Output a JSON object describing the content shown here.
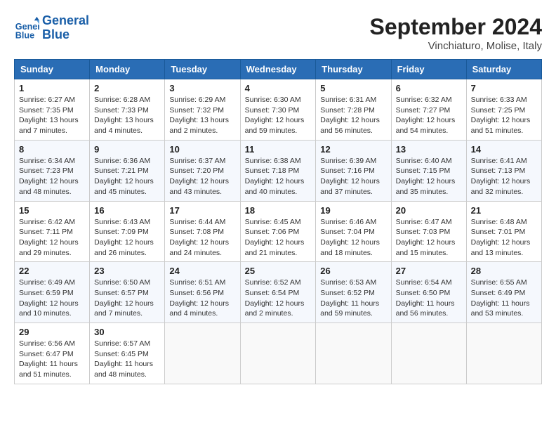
{
  "header": {
    "logo_line1": "General",
    "logo_line2": "Blue",
    "month": "September 2024",
    "location": "Vinchiaturo, Molise, Italy"
  },
  "weekdays": [
    "Sunday",
    "Monday",
    "Tuesday",
    "Wednesday",
    "Thursday",
    "Friday",
    "Saturday"
  ],
  "weeks": [
    [
      {
        "day": "1",
        "info": "Sunrise: 6:27 AM\nSunset: 7:35 PM\nDaylight: 13 hours\nand 7 minutes."
      },
      {
        "day": "2",
        "info": "Sunrise: 6:28 AM\nSunset: 7:33 PM\nDaylight: 13 hours\nand 4 minutes."
      },
      {
        "day": "3",
        "info": "Sunrise: 6:29 AM\nSunset: 7:32 PM\nDaylight: 13 hours\nand 2 minutes."
      },
      {
        "day": "4",
        "info": "Sunrise: 6:30 AM\nSunset: 7:30 PM\nDaylight: 12 hours\nand 59 minutes."
      },
      {
        "day": "5",
        "info": "Sunrise: 6:31 AM\nSunset: 7:28 PM\nDaylight: 12 hours\nand 56 minutes."
      },
      {
        "day": "6",
        "info": "Sunrise: 6:32 AM\nSunset: 7:27 PM\nDaylight: 12 hours\nand 54 minutes."
      },
      {
        "day": "7",
        "info": "Sunrise: 6:33 AM\nSunset: 7:25 PM\nDaylight: 12 hours\nand 51 minutes."
      }
    ],
    [
      {
        "day": "8",
        "info": "Sunrise: 6:34 AM\nSunset: 7:23 PM\nDaylight: 12 hours\nand 48 minutes."
      },
      {
        "day": "9",
        "info": "Sunrise: 6:36 AM\nSunset: 7:21 PM\nDaylight: 12 hours\nand 45 minutes."
      },
      {
        "day": "10",
        "info": "Sunrise: 6:37 AM\nSunset: 7:20 PM\nDaylight: 12 hours\nand 43 minutes."
      },
      {
        "day": "11",
        "info": "Sunrise: 6:38 AM\nSunset: 7:18 PM\nDaylight: 12 hours\nand 40 minutes."
      },
      {
        "day": "12",
        "info": "Sunrise: 6:39 AM\nSunset: 7:16 PM\nDaylight: 12 hours\nand 37 minutes."
      },
      {
        "day": "13",
        "info": "Sunrise: 6:40 AM\nSunset: 7:15 PM\nDaylight: 12 hours\nand 35 minutes."
      },
      {
        "day": "14",
        "info": "Sunrise: 6:41 AM\nSunset: 7:13 PM\nDaylight: 12 hours\nand 32 minutes."
      }
    ],
    [
      {
        "day": "15",
        "info": "Sunrise: 6:42 AM\nSunset: 7:11 PM\nDaylight: 12 hours\nand 29 minutes."
      },
      {
        "day": "16",
        "info": "Sunrise: 6:43 AM\nSunset: 7:09 PM\nDaylight: 12 hours\nand 26 minutes."
      },
      {
        "day": "17",
        "info": "Sunrise: 6:44 AM\nSunset: 7:08 PM\nDaylight: 12 hours\nand 24 minutes."
      },
      {
        "day": "18",
        "info": "Sunrise: 6:45 AM\nSunset: 7:06 PM\nDaylight: 12 hours\nand 21 minutes."
      },
      {
        "day": "19",
        "info": "Sunrise: 6:46 AM\nSunset: 7:04 PM\nDaylight: 12 hours\nand 18 minutes."
      },
      {
        "day": "20",
        "info": "Sunrise: 6:47 AM\nSunset: 7:03 PM\nDaylight: 12 hours\nand 15 minutes."
      },
      {
        "day": "21",
        "info": "Sunrise: 6:48 AM\nSunset: 7:01 PM\nDaylight: 12 hours\nand 13 minutes."
      }
    ],
    [
      {
        "day": "22",
        "info": "Sunrise: 6:49 AM\nSunset: 6:59 PM\nDaylight: 12 hours\nand 10 minutes."
      },
      {
        "day": "23",
        "info": "Sunrise: 6:50 AM\nSunset: 6:57 PM\nDaylight: 12 hours\nand 7 minutes."
      },
      {
        "day": "24",
        "info": "Sunrise: 6:51 AM\nSunset: 6:56 PM\nDaylight: 12 hours\nand 4 minutes."
      },
      {
        "day": "25",
        "info": "Sunrise: 6:52 AM\nSunset: 6:54 PM\nDaylight: 12 hours\nand 2 minutes."
      },
      {
        "day": "26",
        "info": "Sunrise: 6:53 AM\nSunset: 6:52 PM\nDaylight: 11 hours\nand 59 minutes."
      },
      {
        "day": "27",
        "info": "Sunrise: 6:54 AM\nSunset: 6:50 PM\nDaylight: 11 hours\nand 56 minutes."
      },
      {
        "day": "28",
        "info": "Sunrise: 6:55 AM\nSunset: 6:49 PM\nDaylight: 11 hours\nand 53 minutes."
      }
    ],
    [
      {
        "day": "29",
        "info": "Sunrise: 6:56 AM\nSunset: 6:47 PM\nDaylight: 11 hours\nand 51 minutes."
      },
      {
        "day": "30",
        "info": "Sunrise: 6:57 AM\nSunset: 6:45 PM\nDaylight: 11 hours\nand 48 minutes."
      },
      {
        "day": "",
        "info": ""
      },
      {
        "day": "",
        "info": ""
      },
      {
        "day": "",
        "info": ""
      },
      {
        "day": "",
        "info": ""
      },
      {
        "day": "",
        "info": ""
      }
    ]
  ]
}
